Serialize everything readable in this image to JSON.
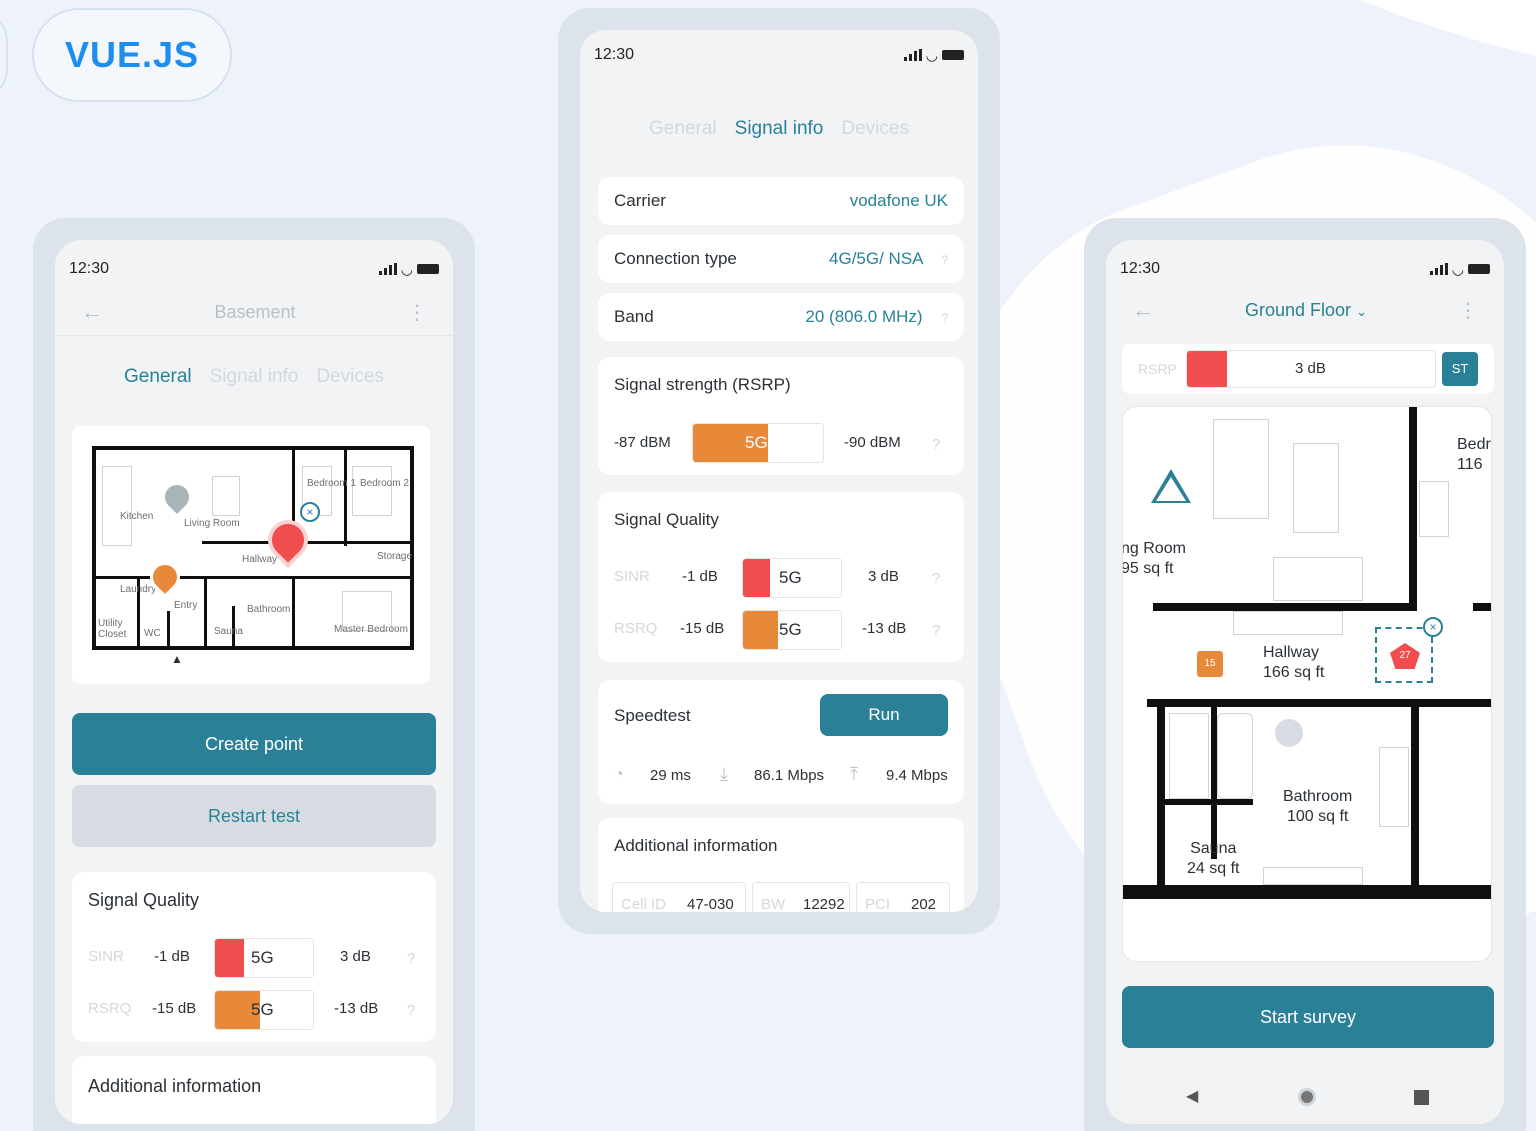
{
  "badge": {
    "label": "VUE.JS"
  },
  "colors": {
    "teal": "#2a8197",
    "red": "#f04e4e",
    "orange": "#e8893a",
    "badge_blue": "#1d8ef0"
  },
  "left": {
    "time": "12:30",
    "floor": "Basement",
    "tabs": [
      "General",
      "Signal info",
      "Devices"
    ],
    "plan_rooms": [
      "Kitchen",
      "Living Room",
      "Bedroom 1",
      "Bedroom 2",
      "Hallway",
      "Storage",
      "Laundry",
      "Entry",
      "Bathroom",
      "Master Bedroom",
      "Utility Closet",
      "WC",
      "Sauna"
    ],
    "create_label": "Create point",
    "restart_label": "Restart test",
    "sq_title": "Signal Quality",
    "sinr": {
      "label": "SINR",
      "min": "-1 dB",
      "bar": "5G",
      "max": "3 dB",
      "help": "?"
    },
    "rsrq": {
      "label": "RSRQ",
      "min": "-15 dB",
      "bar": "5G",
      "max": "-13 dB",
      "help": "?"
    },
    "add_info": "Additional information"
  },
  "middle": {
    "time": "12:30",
    "tabs": [
      "General",
      "Signal info",
      "Devices"
    ],
    "carrier": {
      "label": "Carrier",
      "value": "vodafone UK"
    },
    "conn": {
      "label": "Connection type",
      "value": "4G/5G/ NSA",
      "help": "?"
    },
    "band": {
      "label": "Band",
      "value": "20 (806.0 MHz)",
      "help": "?"
    },
    "strength": {
      "title": "Signal strength (RSRP)",
      "min": "-87 dBM",
      "bar": "5G",
      "max": "-90 dBM",
      "help": "?"
    },
    "quality": {
      "title": "Signal Quality",
      "sinr": {
        "label": "SINR",
        "min": "-1 dB",
        "bar": "5G",
        "max": "3 dB",
        "help": "?"
      },
      "rsrq": {
        "label": "RSRQ",
        "min": "-15 dB",
        "bar": "5G",
        "max": "-13 dB",
        "help": "?"
      }
    },
    "speedtest": {
      "title": "Speedtest",
      "run": "Run",
      "ping": "29 ms",
      "down": "86.1 Mbps",
      "up": "9.4 Mbps"
    },
    "additional": {
      "title": "Additional information",
      "cell_label": "Cell ID",
      "cell": "47-030",
      "bw_label": "BW",
      "bw": "12292",
      "pci_label": "PCI",
      "pci": "202"
    }
  },
  "right": {
    "time": "12:30",
    "floor": "Ground Floor",
    "rsrp_label": "RSRP",
    "rsrp_value": "3 dB",
    "st": "ST",
    "rooms": {
      "bed": "Bedr",
      "bed_size": "116",
      "living": "ng Room",
      "living_size": "95 sq ft",
      "hallway": "Hallway",
      "hallway_size": "166 sq ft",
      "bathroom": "Bathroom",
      "bathroom_size": "100 sq ft",
      "sauna": "Sauna",
      "sauna_size": "24 sq ft"
    },
    "point_orange": "15",
    "point_red": "27",
    "survey_label": "Start survey"
  }
}
